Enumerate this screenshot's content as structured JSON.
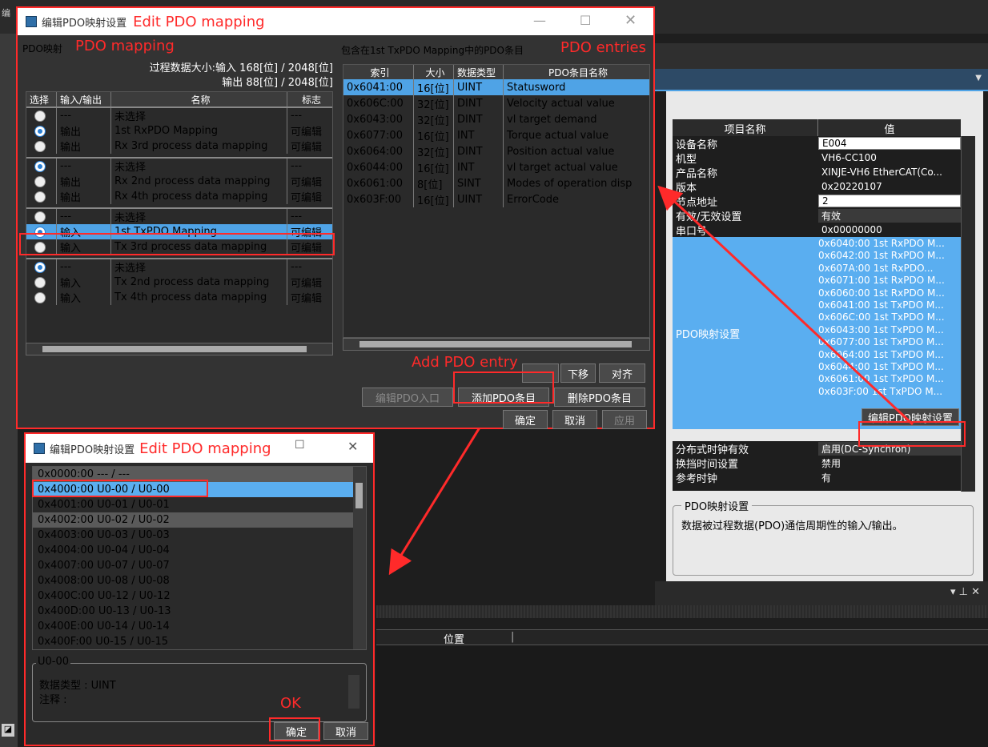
{
  "bg": {
    "menu_fragment": "编",
    "right_panel": {
      "header_name": "项目名称",
      "header_value": "值",
      "props": [
        {
          "name": "设备名称",
          "value": "E004",
          "kind": "input"
        },
        {
          "name": "机型",
          "value": "VH6-CC100"
        },
        {
          "name": "产品名称",
          "value": "XINJE-VH6 EtherCAT(Co..."
        },
        {
          "name": "版本",
          "value": "0x20220107"
        },
        {
          "name": "节点地址",
          "value": "2",
          "kind": "input"
        },
        {
          "name": "有效/无效设置",
          "value": "有效",
          "kind": "select"
        },
        {
          "name": "串口号",
          "value": "0x00000000"
        }
      ],
      "pdo_label": "PDO映射设置",
      "pdo_values": [
        "0x6040:00 1st RxPDO M...",
        "0x6042:00 1st RxPDO M...",
        "0x607A:00 1st RxPDO...",
        "0x6071:00 1st RxPDO M...",
        "0x6060:00 1st RxPDO M...",
        "0x6041:00 1st TxPDO M...",
        "0x606C:00 1st TxPDO M...",
        "0x6043:00 1st TxPDO M...",
        "0x6077:00 1st TxPDO M...",
        "0x6064:00 1st TxPDO M...",
        "0x6044:00 1st TxPDO M...",
        "0x6061:00 1st TxPDO M...",
        "0x603F:00 1st TxPDO M..."
      ],
      "edit_button": "编辑PDO映射设置",
      "props2": [
        {
          "name": "分布式时钟有效",
          "value": "启用(DC-Synchron)",
          "kind": "select"
        },
        {
          "name": "换挡时间设置",
          "value": "禁用"
        },
        {
          "name": "参考时钟",
          "value": "有"
        }
      ],
      "group_title": "PDO映射设置",
      "group_desc": "数据被过程数据(PDO)通信周期性的输入/输出。"
    },
    "bottom_col": "位置"
  },
  "main_dialog": {
    "title": "编辑PDO映射设置",
    "title_annotation": "Edit PDO mapping",
    "left_label": "PDO映射",
    "left_annotation": "PDO mapping",
    "size_input": "过程数据大小:输入 168[位]  /  2048[位]",
    "size_output": "输出 88[位]  /  2048[位]",
    "left_headers": [
      "选择",
      "输入/输出",
      "名称",
      "标志"
    ],
    "groups": [
      [
        {
          "sel": false,
          "io": "---",
          "name": "未选择",
          "flag": "---"
        },
        {
          "sel": true,
          "io": "输出",
          "name": "1st RxPDO Mapping",
          "flag": "可编辑"
        },
        {
          "sel": false,
          "io": "输出",
          "name": "Rx 3rd process data mapping",
          "flag": "可编辑"
        }
      ],
      [
        {
          "sel": true,
          "io": "---",
          "name": "未选择",
          "flag": "---"
        },
        {
          "sel": false,
          "io": "输出",
          "name": "Rx 2nd process data mapping",
          "flag": "可编辑"
        },
        {
          "sel": false,
          "io": "输出",
          "name": "Rx 4th process data mapping",
          "flag": "可编辑"
        }
      ],
      [
        {
          "sel": false,
          "io": "---",
          "name": "未选择",
          "flag": "---"
        },
        {
          "sel": true,
          "io": "输入",
          "name": "1st TxPDO Mapping",
          "flag": "可编辑",
          "highlight": true
        },
        {
          "sel": false,
          "io": "输入",
          "name": "Tx 3rd process data mapping",
          "flag": "可编辑"
        }
      ],
      [
        {
          "sel": true,
          "io": "---",
          "name": "未选择",
          "flag": "---"
        },
        {
          "sel": false,
          "io": "输入",
          "name": "Tx 2nd process data mapping",
          "flag": "可编辑"
        },
        {
          "sel": false,
          "io": "输入",
          "name": "Tx 4th process data mapping",
          "flag": "可编辑"
        }
      ]
    ],
    "right_label": "包含在1st TxPDO Mapping中的PDO条目",
    "right_annotation": "PDO entries",
    "right_headers": [
      "索引",
      "大小",
      "数据类型",
      "PDO条目名称"
    ],
    "entries": [
      {
        "index": "0x6041:00",
        "size": "16[位]",
        "type": "UINT",
        "name": "Statusword"
      },
      {
        "index": "0x606C:00",
        "size": "32[位]",
        "type": "DINT",
        "name": "Velocity actual value"
      },
      {
        "index": "0x6043:00",
        "size": "32[位]",
        "type": "DINT",
        "name": "vl target demand"
      },
      {
        "index": "0x6077:00",
        "size": "16[位]",
        "type": "INT",
        "name": "Torque actual value"
      },
      {
        "index": "0x6064:00",
        "size": "32[位]",
        "type": "DINT",
        "name": "Position actual value"
      },
      {
        "index": "0x6044:00",
        "size": "16[位]",
        "type": "INT",
        "name": "vl target actual value"
      },
      {
        "index": "0x6061:00",
        "size": "8[位]",
        "type": "SINT",
        "name": "Modes of operation disp"
      },
      {
        "index": "0x603F:00",
        "size": "16[位]",
        "type": "UINT",
        "name": "ErrorCode"
      }
    ],
    "add_annotation": "Add PDO entry",
    "btn_move_down": "下移",
    "btn_align": "对齐",
    "btn_edit_entry": "编辑PDO入口",
    "btn_add_entry": "添加PDO条目",
    "btn_delete_entry": "删除PDO条目",
    "btn_ok": "确定",
    "btn_cancel": "取消",
    "btn_apply": "应用"
  },
  "sub_dialog": {
    "title": "编辑PDO映射设置",
    "title_annotation": "Edit PDO mapping",
    "items": [
      "0x0000:00  --- / ---",
      "0x4000:00  U0-00 / U0-00",
      "0x4001:00  U0-01 / U0-01",
      "0x4002:00  U0-02 / U0-02",
      "0x4003:00  U0-03 / U0-03",
      "0x4004:00  U0-04 / U0-04",
      "0x4007:00  U0-07 / U0-07",
      "0x4008:00  U0-08 / U0-08",
      "0x400C:00  U0-12 / U0-12",
      "0x400D:00  U0-13 / U0-13",
      "0x400E:00  U0-14 / U0-14",
      "0x400F:00  U0-15 / U0-15"
    ],
    "group_title": "U0-00",
    "datatype": "数据类型 : UINT",
    "comment": "注释 :",
    "ok_annotation": "OK",
    "btn_ok": "确定",
    "btn_cancel": "取消"
  }
}
